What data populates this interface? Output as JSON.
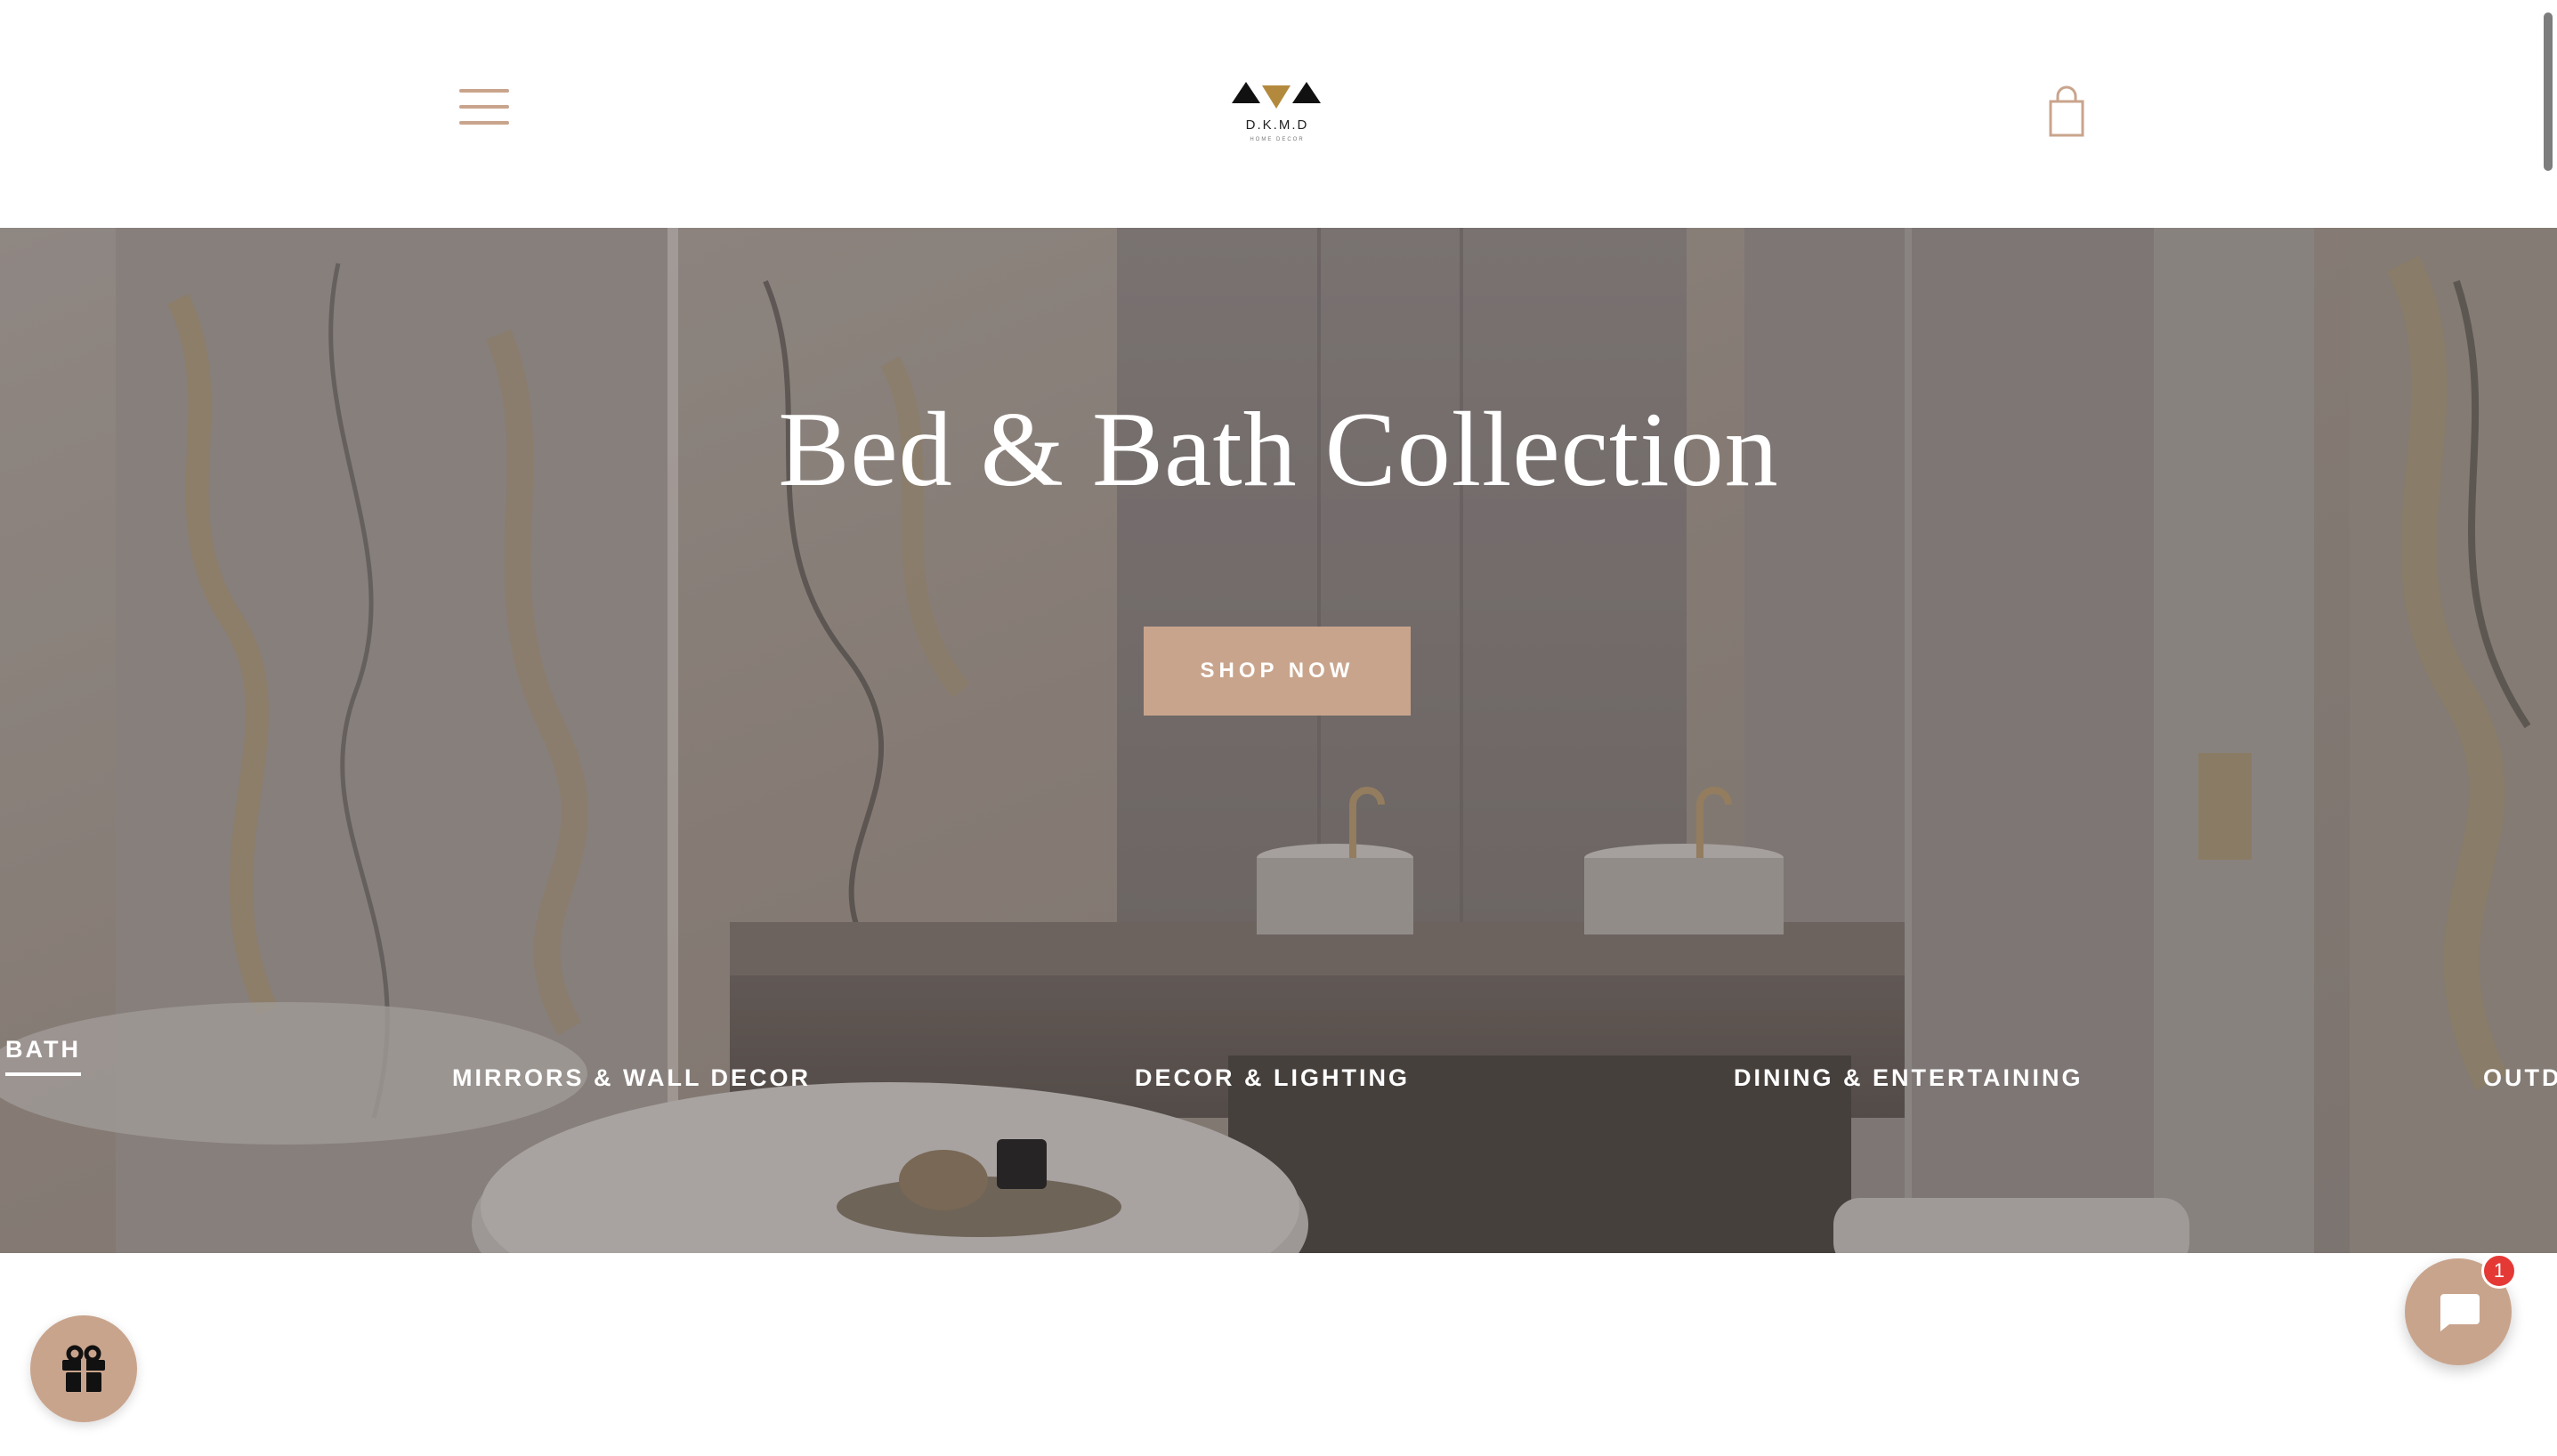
{
  "header": {
    "logo_name": "D.K.M.D",
    "logo_sub": "HOME DECOR"
  },
  "hero": {
    "title": "Bed & Bath Collection",
    "cta_label": "SHOP NOW"
  },
  "categories": [
    {
      "label": "BATH",
      "active": true
    },
    {
      "label": "MIRRORS & WALL DECOR",
      "active": false
    },
    {
      "label": "DECOR & LIGHTING",
      "active": false
    },
    {
      "label": "DINING & ENTERTAINING",
      "active": false
    },
    {
      "label": "OUTD",
      "active": false
    }
  ],
  "chat": {
    "badge_count": "1"
  },
  "colors": {
    "accent": "#c9a48c",
    "badge": "#e53935"
  }
}
